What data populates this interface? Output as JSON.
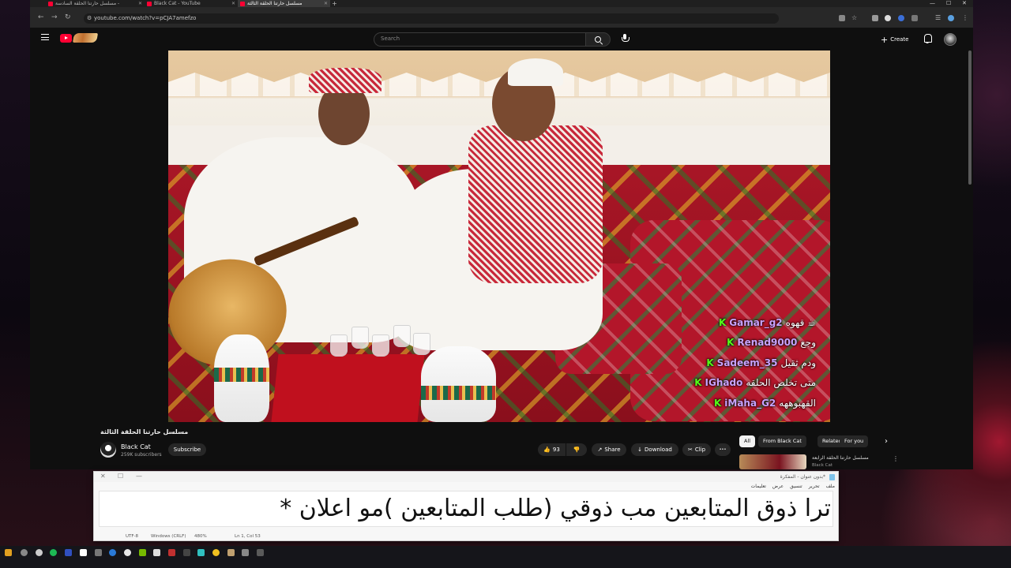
{
  "browser": {
    "tabs": [
      {
        "title": "مسلسل حارتنا الحلقة السادسة - "
      },
      {
        "title": "Black Cat - YouTube"
      },
      {
        "title": "مسلسل حارتنا الحلقة الثالثة"
      }
    ],
    "url": "youtube.com/watch?v=pCJA7amefzo",
    "window_controls": {
      "minimize": "—",
      "maximize": "☐",
      "close": "✕"
    }
  },
  "youtube": {
    "search_placeholder": "Search",
    "create_label": "Create",
    "video": {
      "title": "مسلسل حارتنا الحلقة الثالثة",
      "channel_name": "Black Cat",
      "subscribers": "259K subscribers",
      "subscribe_label": "Subscribe",
      "like_count": "93",
      "share_label": "Share",
      "download_label": "Download",
      "clip_label": "Clip",
      "more_label": "•••"
    },
    "chips": [
      "All",
      "From Black Cat",
      "Related",
      "For you"
    ],
    "recommendation": {
      "title": "مسلسل حارتنا الحلقة الرابعة",
      "channel": "Black Cat"
    },
    "chat_overlay": [
      {
        "badge": "K",
        "user": "Gamar_g2",
        "message": "قهوه ☕"
      },
      {
        "badge": "K",
        "user": "Renad9000",
        "message": "وجع"
      },
      {
        "badge": "K",
        "user": "Sadeem_35",
        "message": "ودم ثقيل"
      },
      {
        "badge": "K",
        "user": "IGhado",
        "message": "متى تخلص الحلقه"
      },
      {
        "badge": "K",
        "user": "iMaha_G2",
        "message": "القهبوههه"
      }
    ],
    "colors": {
      "username": "#c9a3ff",
      "kick_badge": "#53fc18",
      "accent": "#ff0033"
    }
  },
  "notepad": {
    "title": "*بدون عنوان - المفكرة",
    "menu": [
      "ملف",
      "تحرير",
      "تنسيق",
      "عرض",
      "تعليمات"
    ],
    "content": "ترا ذوق المتابعين مب ذوقي (طلب المتابعين )مو اعلان *",
    "status": {
      "encoding": "UTF-8",
      "line_endings": "Windows (CRLF)",
      "zoom": "480%",
      "position": "Ln 1, Col 53"
    },
    "controls": {
      "close": "✕",
      "maximize": "☐",
      "minimize": "—"
    }
  }
}
